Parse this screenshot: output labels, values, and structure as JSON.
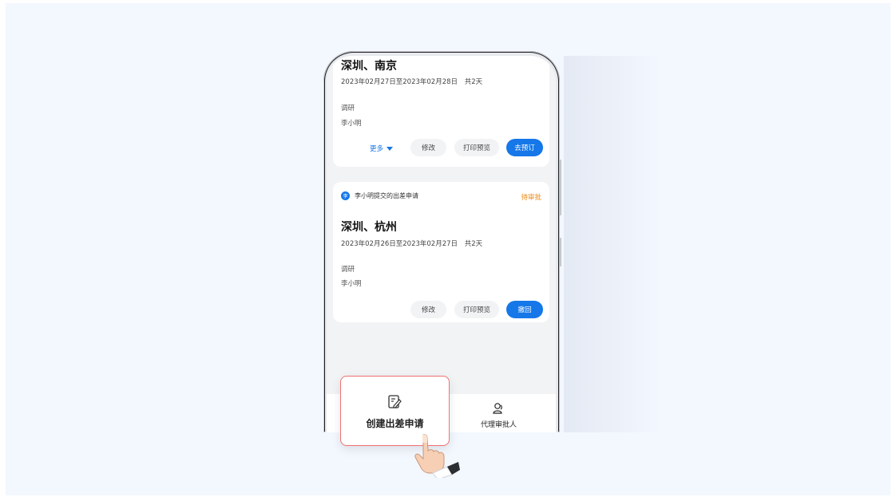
{
  "cards": [
    {
      "title": "深圳、南京",
      "dates": "2023年02月27日至2023年02月28日",
      "duration": "共2天",
      "type": "调研",
      "person": "李小明",
      "actions": {
        "more": "更多",
        "edit": "修改",
        "print": "打印预览",
        "primary": "去预订"
      }
    },
    {
      "submitter_avatar": "李",
      "submitter_text": "李小明提交的出差申请",
      "status": "待审批",
      "title": "深圳、杭州",
      "dates": "2023年02月26日至2023年02月27日",
      "duration": "共2天",
      "type": "调研",
      "person": "李小明",
      "actions": {
        "edit": "修改",
        "print": "打印预览",
        "primary": "撤回"
      }
    }
  ],
  "tabbar": {
    "create": "创建出差申请",
    "proxy": "代理审批人"
  },
  "colors": {
    "accent": "#1577e8",
    "status": "#f08a14",
    "highlight_border": "#f07272"
  },
  "icons": {
    "create": "edit-document-icon",
    "proxy": "person-icon",
    "pointer": "hand-pointer-icon"
  }
}
